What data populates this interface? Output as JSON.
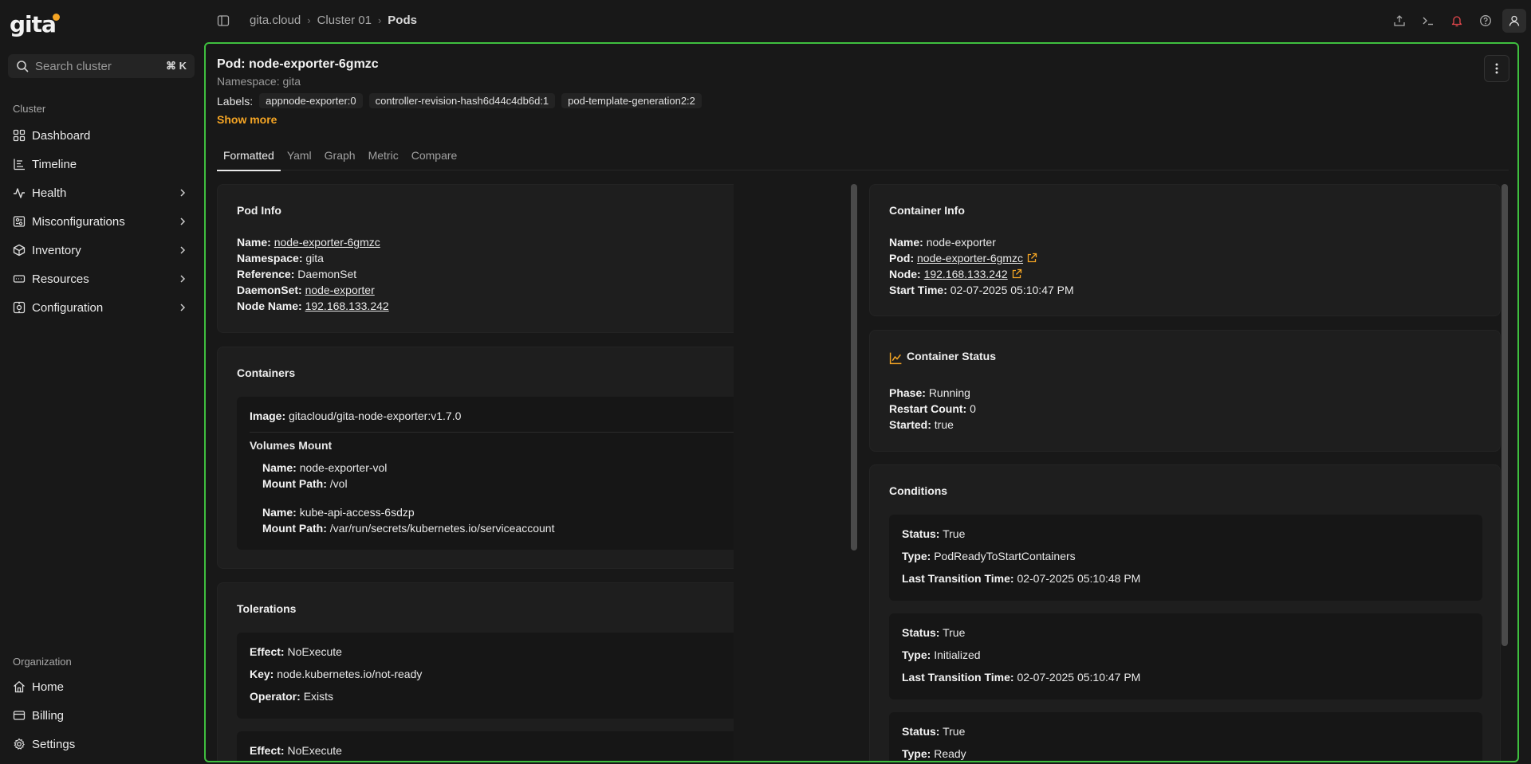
{
  "app": {
    "logo": "gita"
  },
  "sidebar": {
    "search_placeholder": "Search cluster",
    "search_shortcut": "⌘ K",
    "cluster_label": "Cluster",
    "cluster_items": [
      {
        "label": "Dashboard",
        "icon": "grid-icon"
      },
      {
        "label": "Timeline",
        "icon": "timeline-icon"
      },
      {
        "label": "Health",
        "icon": "pulse-icon"
      },
      {
        "label": "Misconfigurations",
        "icon": "misconfig-icon"
      },
      {
        "label": "Inventory",
        "icon": "cube-icon"
      },
      {
        "label": "Resources",
        "icon": "resources-icon"
      },
      {
        "label": "Configuration",
        "icon": "config-icon"
      }
    ],
    "org_label": "Organization",
    "org_items": [
      {
        "label": "Home",
        "icon": "home-icon"
      },
      {
        "label": "Billing",
        "icon": "card-icon"
      },
      {
        "label": "Settings",
        "icon": "gear-icon"
      }
    ]
  },
  "breadcrumb": [
    "gita.cloud",
    "Cluster 01",
    "Pods"
  ],
  "pod": {
    "title": "Pod: node-exporter-6gmzc",
    "namespace": "Namespace: gita",
    "labels_label": "Labels:",
    "labels": [
      "appnode-exporter:0",
      "controller-revision-hash6d44c4db6d:1",
      "pod-template-generation2:2"
    ],
    "show_more": "Show more"
  },
  "tabs": [
    "Formatted",
    "Yaml",
    "Graph",
    "Metric",
    "Compare"
  ],
  "pod_info": {
    "title": "Pod Info",
    "name_k": "Name:",
    "name_v": "node-exporter-6gmzc",
    "namespace_k": "Namespace:",
    "namespace_v": "gita",
    "reference_k": "Reference:",
    "reference_v": "DaemonSet",
    "daemonset_k": "DaemonSet:",
    "daemonset_v": "node-exporter",
    "node_k": "Node Name:",
    "node_v": "192.168.133.242"
  },
  "containers": {
    "title": "Containers",
    "image_k": "Image:",
    "image_v": "gitacloud/gita-node-exporter:v1.7.0",
    "volumes_title": "Volumes Mount",
    "vol1_name_k": "Name:",
    "vol1_name_v": "node-exporter-vol",
    "vol1_path_k": "Mount Path:",
    "vol1_path_v": "/vol",
    "vol2_name_k": "Name:",
    "vol2_name_v": "kube-api-access-6sdzp",
    "vol2_path_k": "Mount Path:",
    "vol2_path_v": "/var/run/secrets/kubernetes.io/serviceaccount"
  },
  "tolerations": {
    "title": "Tolerations",
    "t1_effect_k": "Effect:",
    "t1_effect_v": "NoExecute",
    "t1_key_k": "Key:",
    "t1_key_v": "node.kubernetes.io/not-ready",
    "t1_op_k": "Operator:",
    "t1_op_v": "Exists",
    "t2_effect_k": "Effect:",
    "t2_effect_v": "NoExecute"
  },
  "container_info": {
    "title": "Container Info",
    "name_k": "Name:",
    "name_v": "node-exporter",
    "pod_k": "Pod:",
    "pod_v": "node-exporter-6gmzc",
    "node_k": "Node:",
    "node_v": "192.168.133.242",
    "start_k": "Start Time:",
    "start_v": "02-07-2025 05:10:47 PM"
  },
  "container_status": {
    "title": "Container Status",
    "phase_k": "Phase:",
    "phase_v": "Running",
    "restart_k": "Restart Count:",
    "restart_v": "0",
    "started_k": "Started:",
    "started_v": "true"
  },
  "conditions": {
    "title": "Conditions",
    "c1_status_k": "Status:",
    "c1_status_v": "True",
    "c1_type_k": "Type:",
    "c1_type_v": "PodReadyToStartContainers",
    "c1_time_k": "Last Transition Time:",
    "c1_time_v": "02-07-2025 05:10:48 PM",
    "c2_status_k": "Status:",
    "c2_status_v": "True",
    "c2_type_k": "Type:",
    "c2_type_v": "Initialized",
    "c2_time_k": "Last Transition Time:",
    "c2_time_v": "02-07-2025 05:10:47 PM",
    "c3_status_k": "Status:",
    "c3_status_v": "True",
    "c3_type_k": "Type:",
    "c3_type_v": "Ready"
  },
  "colors": {
    "accent": "#f5a524",
    "focus_border": "#3fbf3f",
    "alert": "#e5484d"
  }
}
